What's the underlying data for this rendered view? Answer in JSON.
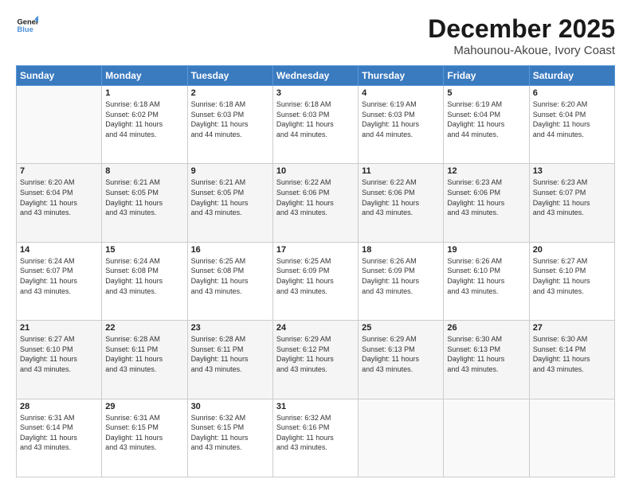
{
  "header": {
    "logo_line1": "General",
    "logo_line2": "Blue",
    "month": "December 2025",
    "location": "Mahounou-Akoue, Ivory Coast"
  },
  "weekdays": [
    "Sunday",
    "Monday",
    "Tuesday",
    "Wednesday",
    "Thursday",
    "Friday",
    "Saturday"
  ],
  "weeks": [
    [
      {
        "day": "",
        "info": ""
      },
      {
        "day": "1",
        "info": "Sunrise: 6:18 AM\nSunset: 6:02 PM\nDaylight: 11 hours\nand 44 minutes."
      },
      {
        "day": "2",
        "info": "Sunrise: 6:18 AM\nSunset: 6:03 PM\nDaylight: 11 hours\nand 44 minutes."
      },
      {
        "day": "3",
        "info": "Sunrise: 6:18 AM\nSunset: 6:03 PM\nDaylight: 11 hours\nand 44 minutes."
      },
      {
        "day": "4",
        "info": "Sunrise: 6:19 AM\nSunset: 6:03 PM\nDaylight: 11 hours\nand 44 minutes."
      },
      {
        "day": "5",
        "info": "Sunrise: 6:19 AM\nSunset: 6:04 PM\nDaylight: 11 hours\nand 44 minutes."
      },
      {
        "day": "6",
        "info": "Sunrise: 6:20 AM\nSunset: 6:04 PM\nDaylight: 11 hours\nand 44 minutes."
      }
    ],
    [
      {
        "day": "7",
        "info": "Sunrise: 6:20 AM\nSunset: 6:04 PM\nDaylight: 11 hours\nand 43 minutes."
      },
      {
        "day": "8",
        "info": "Sunrise: 6:21 AM\nSunset: 6:05 PM\nDaylight: 11 hours\nand 43 minutes."
      },
      {
        "day": "9",
        "info": "Sunrise: 6:21 AM\nSunset: 6:05 PM\nDaylight: 11 hours\nand 43 minutes."
      },
      {
        "day": "10",
        "info": "Sunrise: 6:22 AM\nSunset: 6:06 PM\nDaylight: 11 hours\nand 43 minutes."
      },
      {
        "day": "11",
        "info": "Sunrise: 6:22 AM\nSunset: 6:06 PM\nDaylight: 11 hours\nand 43 minutes."
      },
      {
        "day": "12",
        "info": "Sunrise: 6:23 AM\nSunset: 6:06 PM\nDaylight: 11 hours\nand 43 minutes."
      },
      {
        "day": "13",
        "info": "Sunrise: 6:23 AM\nSunset: 6:07 PM\nDaylight: 11 hours\nand 43 minutes."
      }
    ],
    [
      {
        "day": "14",
        "info": "Sunrise: 6:24 AM\nSunset: 6:07 PM\nDaylight: 11 hours\nand 43 minutes."
      },
      {
        "day": "15",
        "info": "Sunrise: 6:24 AM\nSunset: 6:08 PM\nDaylight: 11 hours\nand 43 minutes."
      },
      {
        "day": "16",
        "info": "Sunrise: 6:25 AM\nSunset: 6:08 PM\nDaylight: 11 hours\nand 43 minutes."
      },
      {
        "day": "17",
        "info": "Sunrise: 6:25 AM\nSunset: 6:09 PM\nDaylight: 11 hours\nand 43 minutes."
      },
      {
        "day": "18",
        "info": "Sunrise: 6:26 AM\nSunset: 6:09 PM\nDaylight: 11 hours\nand 43 minutes."
      },
      {
        "day": "19",
        "info": "Sunrise: 6:26 AM\nSunset: 6:10 PM\nDaylight: 11 hours\nand 43 minutes."
      },
      {
        "day": "20",
        "info": "Sunrise: 6:27 AM\nSunset: 6:10 PM\nDaylight: 11 hours\nand 43 minutes."
      }
    ],
    [
      {
        "day": "21",
        "info": "Sunrise: 6:27 AM\nSunset: 6:10 PM\nDaylight: 11 hours\nand 43 minutes."
      },
      {
        "day": "22",
        "info": "Sunrise: 6:28 AM\nSunset: 6:11 PM\nDaylight: 11 hours\nand 43 minutes."
      },
      {
        "day": "23",
        "info": "Sunrise: 6:28 AM\nSunset: 6:11 PM\nDaylight: 11 hours\nand 43 minutes."
      },
      {
        "day": "24",
        "info": "Sunrise: 6:29 AM\nSunset: 6:12 PM\nDaylight: 11 hours\nand 43 minutes."
      },
      {
        "day": "25",
        "info": "Sunrise: 6:29 AM\nSunset: 6:13 PM\nDaylight: 11 hours\nand 43 minutes."
      },
      {
        "day": "26",
        "info": "Sunrise: 6:30 AM\nSunset: 6:13 PM\nDaylight: 11 hours\nand 43 minutes."
      },
      {
        "day": "27",
        "info": "Sunrise: 6:30 AM\nSunset: 6:14 PM\nDaylight: 11 hours\nand 43 minutes."
      }
    ],
    [
      {
        "day": "28",
        "info": "Sunrise: 6:31 AM\nSunset: 6:14 PM\nDaylight: 11 hours\nand 43 minutes."
      },
      {
        "day": "29",
        "info": "Sunrise: 6:31 AM\nSunset: 6:15 PM\nDaylight: 11 hours\nand 43 minutes."
      },
      {
        "day": "30",
        "info": "Sunrise: 6:32 AM\nSunset: 6:15 PM\nDaylight: 11 hours\nand 43 minutes."
      },
      {
        "day": "31",
        "info": "Sunrise: 6:32 AM\nSunset: 6:16 PM\nDaylight: 11 hours\nand 43 minutes."
      },
      {
        "day": "",
        "info": ""
      },
      {
        "day": "",
        "info": ""
      },
      {
        "day": "",
        "info": ""
      }
    ]
  ]
}
